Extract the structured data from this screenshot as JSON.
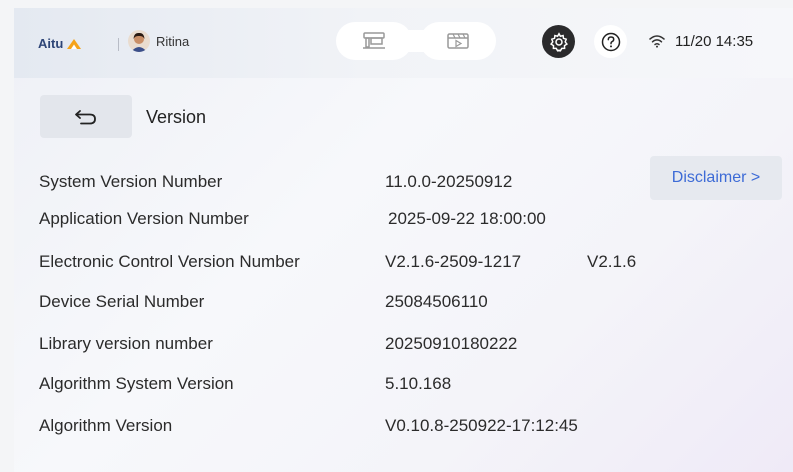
{
  "header": {
    "brand": "Aitu",
    "user_name": "Ritina",
    "datetime": "11/20 14:35",
    "colors": {
      "brand_text": "#2e4577",
      "brand_mark": "#f5a31a",
      "settings_bg": "#2a2a2c"
    },
    "icons": {
      "mode_left": "machine-icon",
      "mode_right": "video-library-icon",
      "settings": "gear-icon",
      "help": "question-icon",
      "wifi": "wifi-icon"
    }
  },
  "page": {
    "title": "Version",
    "disclaimer_label": "Disclaimer >",
    "accent_color": "#3d6bd6"
  },
  "info": [
    {
      "label": "System Version Number",
      "value": "11.0.0-20250912",
      "extra": ""
    },
    {
      "label": "Application Version Number",
      "value": "2025-09-22 18:00:00",
      "extra": ""
    },
    {
      "label": "Electronic Control Version Number",
      "value": "V2.1.6-2509-1217",
      "extra": "V2.1.6"
    },
    {
      "label": "Device Serial Number",
      "value": "25084506110",
      "extra": ""
    },
    {
      "label": "Library version number",
      "value": "20250910180222",
      "extra": ""
    },
    {
      "label": "Algorithm System Version",
      "value": "5.10.168",
      "extra": ""
    },
    {
      "label": "Algorithm Version",
      "value": "V0.10.8-250922-17:12:45",
      "extra": ""
    }
  ]
}
